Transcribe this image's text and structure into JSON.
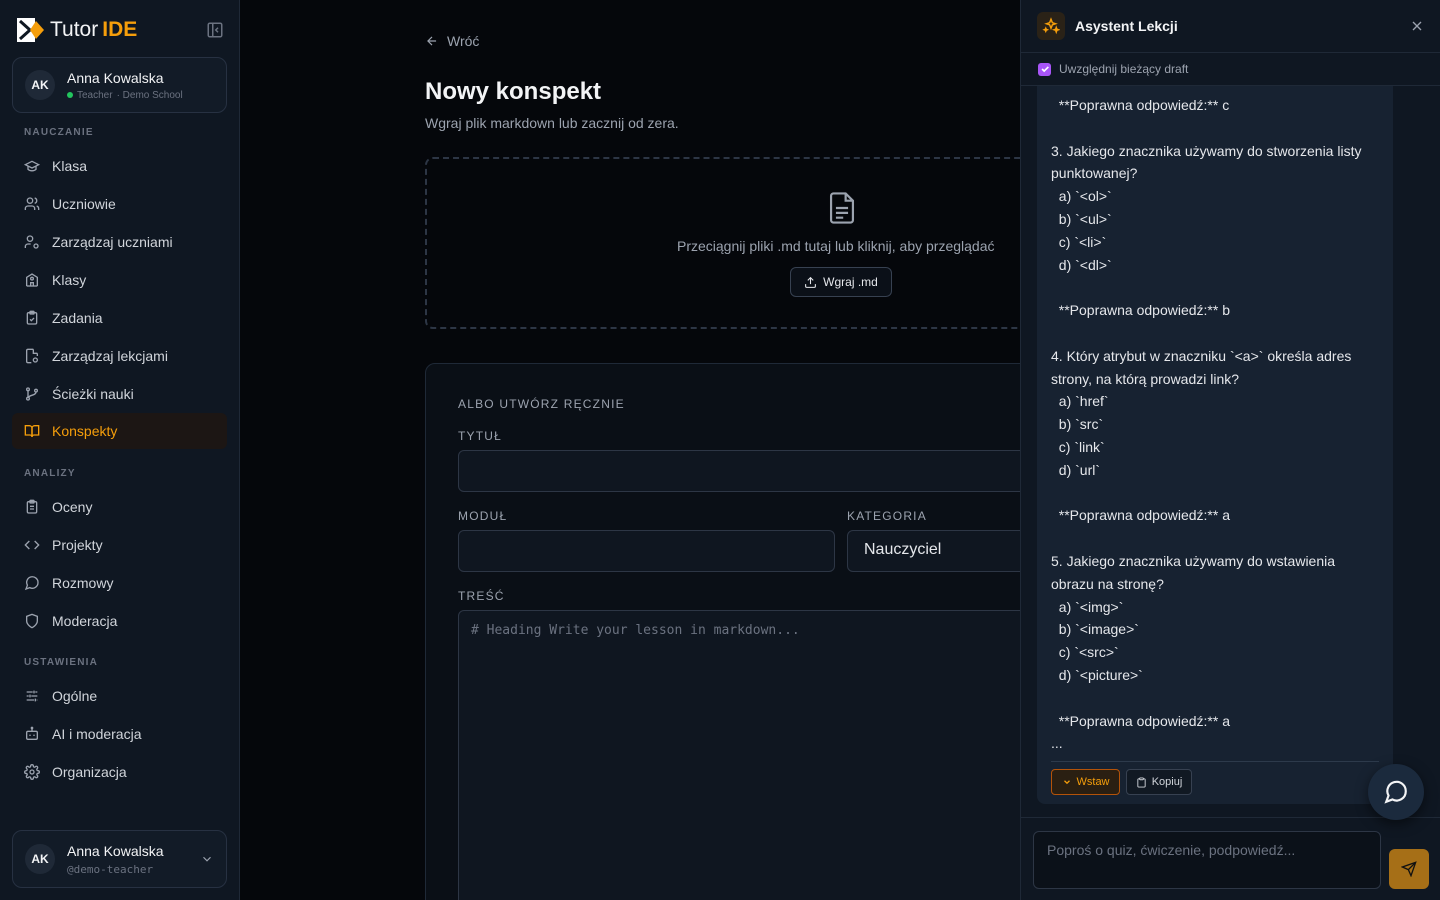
{
  "brand": {
    "name_part": "Tutor",
    "name_accent": "IDE"
  },
  "user": {
    "initials": "AK",
    "name": "Anna Kowalska",
    "role": "Teacher",
    "school": "· Demo School",
    "handle": "@demo-teacher"
  },
  "sidebar": {
    "sections": [
      {
        "label": "NAUCZANIE"
      },
      {
        "label": "ANALIZY"
      },
      {
        "label": "USTAWIENIA"
      }
    ],
    "items": [
      {
        "label": "Klasa",
        "icon": "graduation-cap-icon"
      },
      {
        "label": "Uczniowie",
        "icon": "users-icon"
      },
      {
        "label": "Zarządzaj uczniami",
        "icon": "user-cog-icon"
      },
      {
        "label": "Klasy",
        "icon": "school-icon"
      },
      {
        "label": "Zadania",
        "icon": "clipboard-check-icon"
      },
      {
        "label": "Zarządzaj lekcjami",
        "icon": "file-cog-icon"
      },
      {
        "label": "Ścieżki nauki",
        "icon": "git-branch-icon"
      },
      {
        "label": "Konspekty",
        "icon": "book-open-icon",
        "active": true
      },
      {
        "label": "Oceny",
        "icon": "clipboard-list-icon"
      },
      {
        "label": "Projekty",
        "icon": "code-icon"
      },
      {
        "label": "Rozmowy",
        "icon": "message-circle-icon"
      },
      {
        "label": "Moderacja",
        "icon": "shield-icon"
      },
      {
        "label": "Ogólne",
        "icon": "sliders-icon"
      },
      {
        "label": "AI i moderacja",
        "icon": "bot-icon"
      },
      {
        "label": "Organizacja",
        "icon": "gear-icon"
      }
    ]
  },
  "main": {
    "back_label": "Wróć",
    "title": "Nowy konspekt",
    "subtitle": "Wgraj plik markdown lub zacznij od zera.",
    "dropzone": {
      "text": "Przeciągnij pliki .md tutaj lub kliknij, aby przeglądać",
      "button": "Wgraj .md"
    },
    "form": {
      "section_label": "ALBO UTWÓRZ RĘCZNIE",
      "title_label": "TYTUŁ",
      "title_value": "",
      "module_label": "MODUŁ",
      "module_value": "",
      "category_label": "KATEGORIA",
      "category_value": "Nauczyciel",
      "content_label": "TREŚĆ",
      "content_placeholder": "# Heading  Write your lesson in markdown..."
    }
  },
  "assistant": {
    "title": "Asystent Lekcji",
    "include_draft_label": "Uwzględnij bieżący draft",
    "include_draft_checked": true,
    "message_lines": [
      "  **Poprawna odpowiedź:** c",
      "",
      "3. Jakiego znacznika używamy do stworzenia listy",
      "punktowanej?",
      "  a) `<ol>`",
      "  b) `<ul>`",
      "  c) `<li>`",
      "  d) `<dl>`",
      "",
      "  **Poprawna odpowiedź:** b",
      "",
      "4. Który atrybut w znaczniku `<a>` określa adres",
      "strony, na którą prowadzi link?",
      "  a) `href`",
      "  b) `src`",
      "  c) `link`",
      "  d) `url`",
      "",
      "  **Poprawna odpowiedź:** a",
      "",
      "5. Jakiego znacznika używamy do wstawienia",
      "obrazu na stronę?",
      "  a) `<img>`",
      "  b) `<image>`",
      "  c) `<src>`",
      "  d) `<picture>`",
      "",
      "  **Poprawna odpowiedź:** a",
      "..."
    ],
    "insert_label": "Wstaw",
    "copy_label": "Kopiuj",
    "input_placeholder": "Poproś o quiz, ćwiczenie, podpowiedź...",
    "accent": "#f59e0b"
  }
}
